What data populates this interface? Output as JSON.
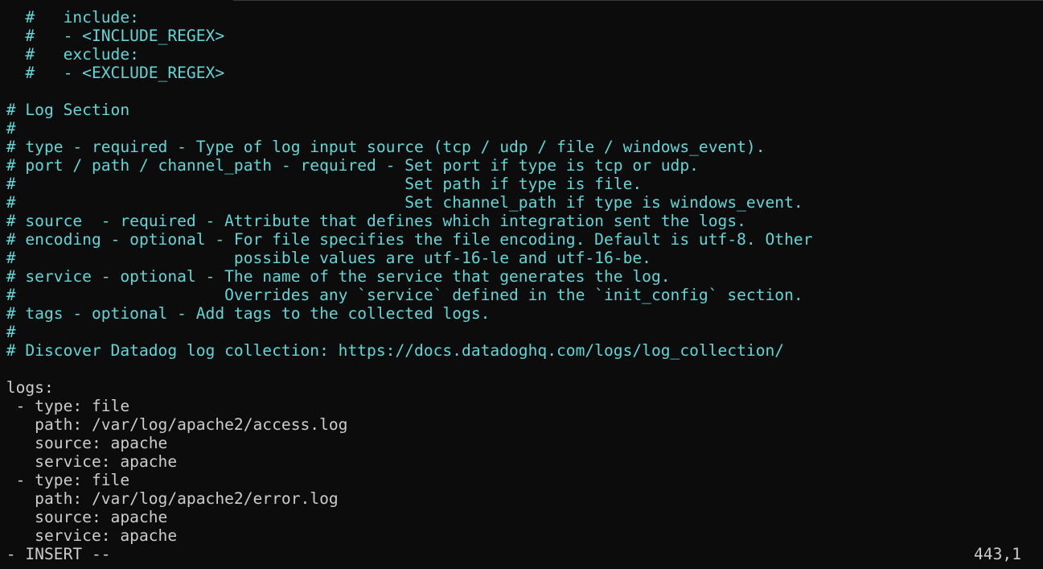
{
  "editor": {
    "lines": [
      {
        "text": "   #   include:",
        "kind": "comment"
      },
      {
        "text": "   #   - <INCLUDE_REGEX>",
        "kind": "comment"
      },
      {
        "text": "   #   exclude:",
        "kind": "comment"
      },
      {
        "text": "   #   - <EXCLUDE_REGEX>",
        "kind": "comment"
      },
      {
        "text": "",
        "kind": "code"
      },
      {
        "text": " # Log Section",
        "kind": "comment"
      },
      {
        "text": " #",
        "kind": "comment"
      },
      {
        "text": " # type - required - Type of log input source (tcp / udp / file / windows_event).",
        "kind": "comment"
      },
      {
        "text": " # port / path / channel_path - required - Set port if type is tcp or udp.",
        "kind": "comment"
      },
      {
        "text": " #                                         Set path if type is file.",
        "kind": "comment"
      },
      {
        "text": " #                                         Set channel_path if type is windows_event.",
        "kind": "comment"
      },
      {
        "text": " # source  - required - Attribute that defines which integration sent the logs.",
        "kind": "comment"
      },
      {
        "text": " # encoding - optional - For file specifies the file encoding. Default is utf-8. Other",
        "kind": "comment"
      },
      {
        "text": " #                       possible values are utf-16-le and utf-16-be.",
        "kind": "comment"
      },
      {
        "text": " # service - optional - The name of the service that generates the log.",
        "kind": "comment"
      },
      {
        "text": " #                      Overrides any `service` defined in the `init_config` section.",
        "kind": "comment"
      },
      {
        "text": " # tags - optional - Add tags to the collected logs.",
        "kind": "comment"
      },
      {
        "text": " #",
        "kind": "comment"
      },
      {
        "text": " # Discover Datadog log collection: https://docs.datadoghq.com/logs/log_collection/",
        "kind": "comment"
      },
      {
        "text": "",
        "kind": "code"
      },
      {
        "text": " logs:",
        "kind": "code"
      },
      {
        "text": "  - type: file",
        "kind": "code"
      },
      {
        "text": "    path: /var/log/apache2/access.log",
        "kind": "code"
      },
      {
        "text": "    source: apache",
        "kind": "code"
      },
      {
        "text": "    service: apache",
        "kind": "code"
      },
      {
        "text": "  - type: file",
        "kind": "code"
      },
      {
        "text": "    path: /var/log/apache2/error.log",
        "kind": "code"
      },
      {
        "text": "    source: apache",
        "kind": "code"
      },
      {
        "text": "    service: apache",
        "kind": "code"
      }
    ]
  },
  "status_bar": {
    "mode": " - INSERT --",
    "position": "443,1"
  },
  "colors": {
    "background": "#0c0c0c",
    "comment": "#61d6d6",
    "text": "#cccccc"
  }
}
